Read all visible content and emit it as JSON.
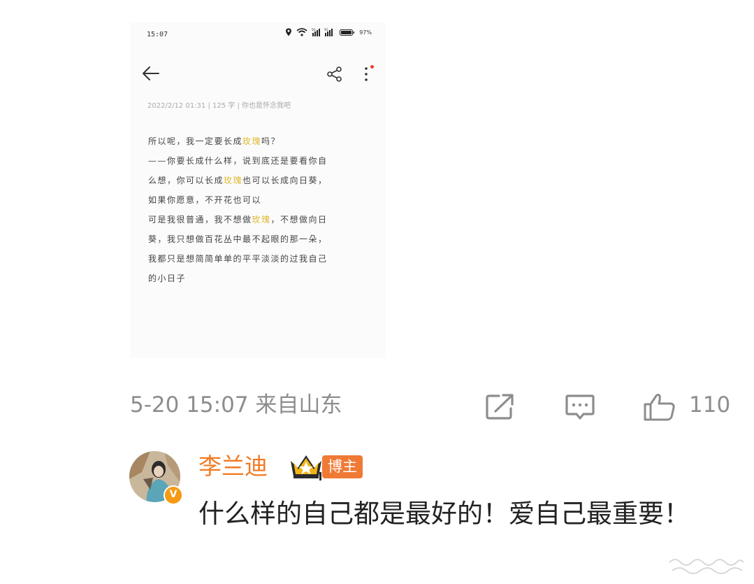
{
  "phone": {
    "status_time": "15:07",
    "status_battery": "97%",
    "note_meta": "2022/2/12 01:31  |  125 字  |  你也是怀念我吧",
    "note_lines": [
      [
        "所以呢，我一定要长成",
        "玫瑰",
        "吗？"
      ],
      [
        "——你要长成什么样，说到底还是要看你自",
        "",
        ""
      ],
      [
        "么想，你可以长成",
        "玫瑰",
        "也可以长成向日葵，"
      ],
      [
        "如果你愿意，不开花也可以",
        "",
        ""
      ],
      [
        "可是我很普通，我不想做",
        "玫瑰",
        "，不想做向日"
      ],
      [
        "葵，我只想做百花丛中最不起眼的那一朵，",
        "",
        ""
      ],
      [
        "我都只是想简简单单的平平淡淡的过我自己",
        "",
        ""
      ],
      [
        "的小日子",
        "",
        ""
      ]
    ],
    "icons": [
      "back-arrow-icon",
      "share-icon",
      "more-icon",
      "location-icon",
      "wifi-icon",
      "signal-icon",
      "battery-icon"
    ]
  },
  "post": {
    "time_location": "5-20 15:07 来自山东",
    "like_count": "110",
    "icons": [
      "repost-icon",
      "comment-icon",
      "like-icon"
    ]
  },
  "comment": {
    "username": "李兰迪",
    "badge": "博主",
    "verified": "V",
    "text": "什么样的自己都是最好的！爱自己最重要！",
    "icons": [
      "crown-icon",
      "verified-icon"
    ]
  },
  "colors": {
    "accent": "#f27a22",
    "highlight": "#e0b830",
    "muted": "#8d8d8d",
    "badge": "#f07a35"
  }
}
